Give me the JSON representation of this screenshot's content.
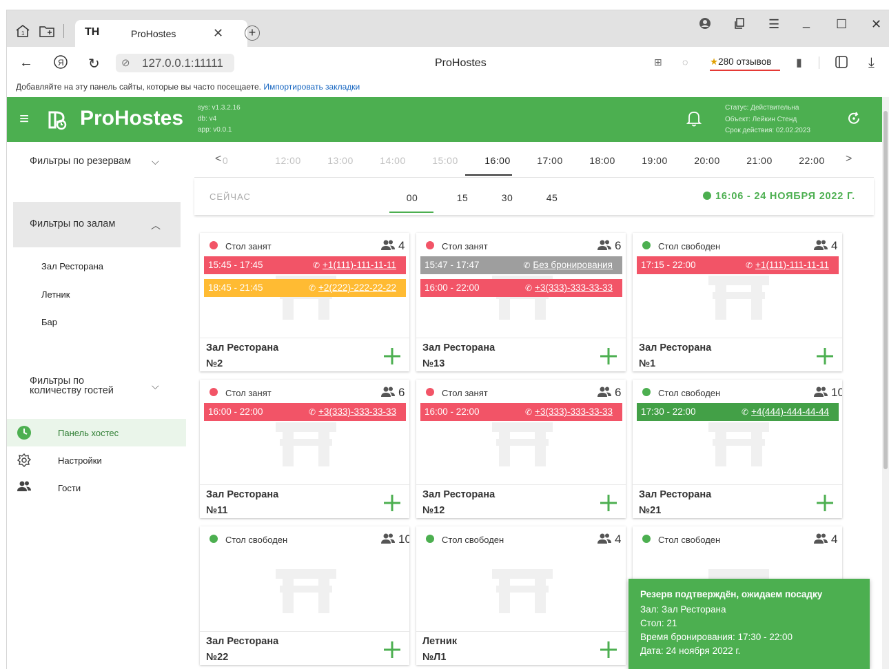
{
  "browser": {
    "tab_logo": "TH",
    "tab_title": "ProHostes",
    "address": "127.0.0.1:11111",
    "page_title": "ProHostes",
    "reviews": "280 отзывов",
    "bookmarks_bar_text": "Добавляйте на эту панель сайты, которые вы часто посещаете.",
    "bookmarks_bar_link": "Импортировать закладки"
  },
  "app": {
    "logo_text": "ProHostes",
    "version": {
      "sys": "sys: v1.3.2.16",
      "db": "db: v4",
      "app": "app: v0.0.1"
    },
    "status": {
      "line1": "Статус: Действительна",
      "line2": "Объект: Лейкин Стенд",
      "line3": "Срок действия: 02.02.2023"
    },
    "accent": "#4caf50"
  },
  "sidebar": {
    "filter_reserves": "Фильтры по резервам",
    "filter_halls": "Фильтры по залам",
    "halls": [
      "Зал Ресторана",
      "Летник",
      "Бар"
    ],
    "filter_guests_l1": "Фильтры по",
    "filter_guests_l2": "количеству гостей",
    "menu": [
      {
        "label": "Панель хостес",
        "icon": "clock-icon",
        "active": true
      },
      {
        "label": "Настройки",
        "icon": "gear-icon",
        "active": false
      },
      {
        "label": "Гости",
        "icon": "people-icon",
        "active": false
      }
    ]
  },
  "timeline": {
    "hours": [
      "0",
      "12:00",
      "13:00",
      "14:00",
      "15:00",
      "16:00",
      "17:00",
      "18:00",
      "19:00",
      "20:00",
      "21:00",
      "22:00"
    ],
    "now_label": "СЕЙЧАС",
    "minutes": [
      "00",
      "15",
      "30",
      "45"
    ],
    "current": "16:06 - 24 НОЯБРЯ 2022 Г."
  },
  "colors": {
    "busy": "#f25467",
    "free": "#4caf50",
    "pending": "#ffbb33",
    "none": "#9e9e9e"
  },
  "tables": [
    {
      "status": "Стол занят",
      "busy": true,
      "guests": "4",
      "hall": "Зал Ресторана",
      "num": "№2",
      "res": [
        {
          "time": "15:45 - 17:45",
          "phone": "+1(111)-111-11-11",
          "color": "#f25467"
        },
        {
          "time": "18:45 - 21:45",
          "phone": "+2(222)-222-22-22",
          "color": "#ffbb33"
        }
      ]
    },
    {
      "status": "Стол занят",
      "busy": true,
      "guests": "6",
      "hall": "Зал Ресторана",
      "num": "№13",
      "res": [
        {
          "time": "15:47 - 17:47",
          "phone": "Без бронирования",
          "color": "#9e9e9e"
        },
        {
          "time": "16:00 - 22:00",
          "phone": "+3(333)-333-33-33",
          "color": "#f25467"
        }
      ]
    },
    {
      "status": "Стол свободен",
      "busy": false,
      "guests": "4",
      "hall": "Зал Ресторана",
      "num": "№1",
      "res": [
        {
          "time": "17:15 - 22:00",
          "phone": "+1(111)-111-11-11",
          "color": "#f25467"
        }
      ]
    },
    {
      "status": "Стол занят",
      "busy": true,
      "guests": "6",
      "hall": "Зал Ресторана",
      "num": "№11",
      "res": [
        {
          "time": "16:00 - 22:00",
          "phone": "+3(333)-333-33-33",
          "color": "#f25467"
        }
      ]
    },
    {
      "status": "Стол занят",
      "busy": true,
      "guests": "6",
      "hall": "Зал Ресторана",
      "num": "№12",
      "res": [
        {
          "time": "16:00 - 22:00",
          "phone": "+3(333)-333-33-33",
          "color": "#f25467"
        }
      ]
    },
    {
      "status": "Стол свободен",
      "busy": false,
      "guests": "10",
      "hall": "Зал Ресторана",
      "num": "№21",
      "res": [
        {
          "time": "17:30 - 22:00",
          "phone": "+4(444)-444-44-44",
          "color": "#43a047"
        }
      ]
    },
    {
      "status": "Стол свободен",
      "busy": false,
      "guests": "10",
      "hall": "Зал Ресторана",
      "num": "№22",
      "res": []
    },
    {
      "status": "Стол свободен",
      "busy": false,
      "guests": "4",
      "hall": "Летник",
      "num": "№Л1",
      "res": []
    },
    {
      "status": "Стол свободен",
      "busy": false,
      "guests": "4",
      "hall": "",
      "num": "",
      "res": []
    }
  ],
  "snackbar": {
    "title": "Резерв подтверждён, ожидаем посадку",
    "hall": "Зал: Зал Ресторана",
    "table": "Стол: 21",
    "time": "Время бронирования: 17:30 - 22:00",
    "date": "Дата: 24 ноября 2022 г."
  }
}
